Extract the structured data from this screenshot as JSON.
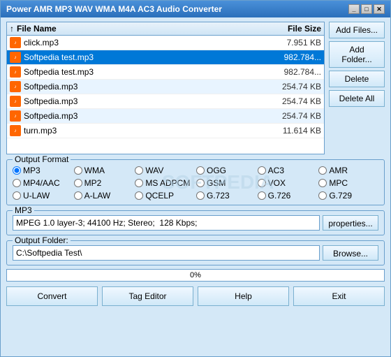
{
  "window": {
    "title": "Power AMR MP3 WAV WMA M4A AC3 Audio Converter",
    "controls": {
      "minimize": "_",
      "maximize": "□",
      "close": "✕"
    }
  },
  "fileList": {
    "columns": {
      "name": "File Name",
      "size": "File Size",
      "sort_arrow": "↑"
    },
    "files": [
      {
        "name": "click.mp3",
        "size": "7.951 KB",
        "selected": false
      },
      {
        "name": "Softpedia test.mp3",
        "size": "982.784...",
        "selected": true
      },
      {
        "name": "Softpedia test.mp3",
        "size": "982.784...",
        "selected": false
      },
      {
        "name": "Softpedia.mp3",
        "size": "254.74 KB",
        "selected": false
      },
      {
        "name": "Softpedia.mp3",
        "size": "254.74 KB",
        "selected": false
      },
      {
        "name": "Softpedia.mp3",
        "size": "254.74 KB",
        "selected": false
      },
      {
        "name": "turn.mp3",
        "size": "11.614 KB",
        "selected": false
      }
    ]
  },
  "sideButtons": {
    "addFiles": "Add Files...",
    "addFolder": "Add Folder...",
    "delete": "Delete",
    "deleteAll": "Delete All"
  },
  "outputFormat": {
    "label": "Output Format",
    "watermark": "SOFTPEDIA",
    "formats": [
      [
        {
          "id": "mp3",
          "label": "MP3",
          "checked": true
        },
        {
          "id": "wma",
          "label": "WMA",
          "checked": false
        },
        {
          "id": "wav",
          "label": "WAV",
          "checked": false
        },
        {
          "id": "ogg",
          "label": "OGG",
          "checked": false
        },
        {
          "id": "ac3",
          "label": "AC3",
          "checked": false
        },
        {
          "id": "amr",
          "label": "AMR",
          "checked": false
        }
      ],
      [
        {
          "id": "mp4aac",
          "label": "MP4/AAC",
          "checked": false
        },
        {
          "id": "mp2",
          "label": "MP2",
          "checked": false
        },
        {
          "id": "msadpcm",
          "label": "MS ADPCM",
          "checked": false
        },
        {
          "id": "gsm",
          "label": "GSM",
          "checked": false
        },
        {
          "id": "vox",
          "label": "VOX",
          "checked": false
        },
        {
          "id": "mpc",
          "label": "MPC",
          "checked": false
        }
      ],
      [
        {
          "id": "ulaw",
          "label": "U-LAW",
          "checked": false
        },
        {
          "id": "alaw",
          "label": "A-LAW",
          "checked": false
        },
        {
          "id": "qcelp",
          "label": "QCELP",
          "checked": false
        },
        {
          "id": "g723",
          "label": "G.723",
          "checked": false
        },
        {
          "id": "g726",
          "label": "G.726",
          "checked": false
        },
        {
          "id": "g729",
          "label": "G.729",
          "checked": false
        }
      ]
    ]
  },
  "mp3Section": {
    "label": "MP3",
    "description": "MPEG 1.0 layer-3; 44100 Hz; Stereo;  128 Kbps;",
    "propertiesBtn": "properties..."
  },
  "outputFolder": {
    "label": "Output Folder:",
    "path": "C:\\Softpedia Test\\",
    "browseBtn": "Browse..."
  },
  "progress": {
    "percent": "0%",
    "value": 0
  },
  "bottomButtons": {
    "convert": "Convert",
    "tagEditor": "Tag Editor",
    "help": "Help",
    "exit": "Exit"
  }
}
